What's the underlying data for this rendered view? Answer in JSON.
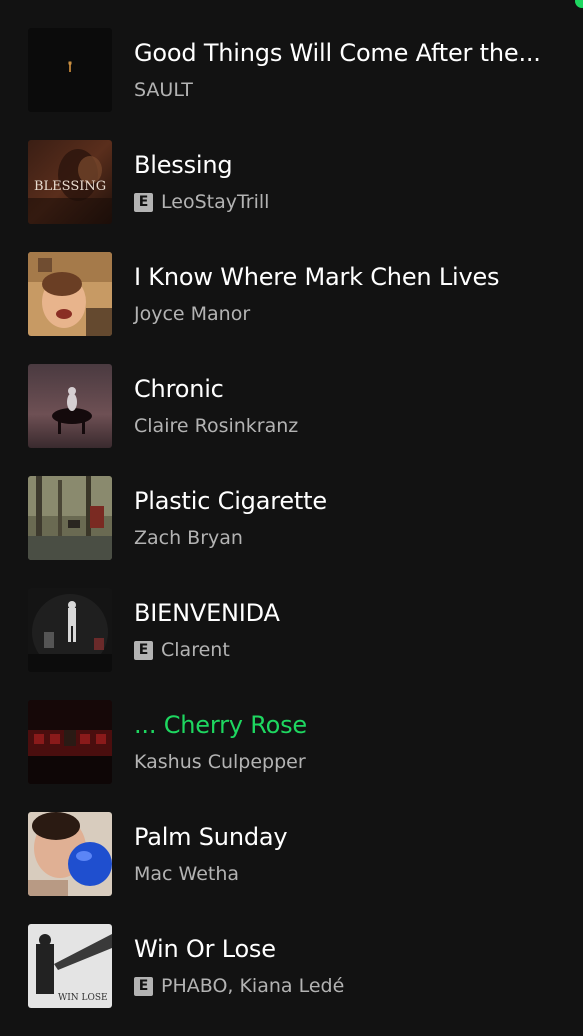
{
  "accent_color": "#1ed760",
  "tracks": [
    {
      "title": "Good Things Will Come After the...",
      "artist": "SAULT",
      "explicit": false,
      "playing": false,
      "art_icon": "sault-album-art",
      "art_text": ""
    },
    {
      "title": "Blessing",
      "artist": "LeoStayTrill",
      "explicit": true,
      "playing": false,
      "art_icon": "blessing-album-art",
      "art_text": "BLESSING"
    },
    {
      "title": "I Know Where Mark Chen Lives",
      "artist": "Joyce Manor",
      "explicit": false,
      "playing": false,
      "art_icon": "joyce-manor-album-art",
      "art_text": ""
    },
    {
      "title": "Chronic",
      "artist": "Claire Rosinkranz",
      "explicit": false,
      "playing": false,
      "art_icon": "chronic-album-art",
      "art_text": ""
    },
    {
      "title": "Plastic Cigarette",
      "artist": "Zach Bryan",
      "explicit": false,
      "playing": false,
      "art_icon": "plastic-cigarette-album-art",
      "art_text": ""
    },
    {
      "title": "BIENVENIDA",
      "artist": "Clarent",
      "explicit": true,
      "playing": false,
      "art_icon": "bienvenida-album-art",
      "art_text": ""
    },
    {
      "title": "... Cherry Rose",
      "artist": "Kashus Culpepper",
      "explicit": false,
      "playing": true,
      "art_icon": "cherry-rose-album-art",
      "art_text": ""
    },
    {
      "title": "Palm Sunday",
      "artist": "Mac Wetha",
      "explicit": false,
      "playing": false,
      "art_icon": "palm-sunday-album-art",
      "art_text": ""
    },
    {
      "title": "Win Or Lose",
      "artist": "PHABO, Kiana Ledé",
      "explicit": true,
      "playing": false,
      "art_icon": "win-or-lose-album-art",
      "art_text": "WIN LOSE"
    }
  ],
  "explicit_badge": "E"
}
